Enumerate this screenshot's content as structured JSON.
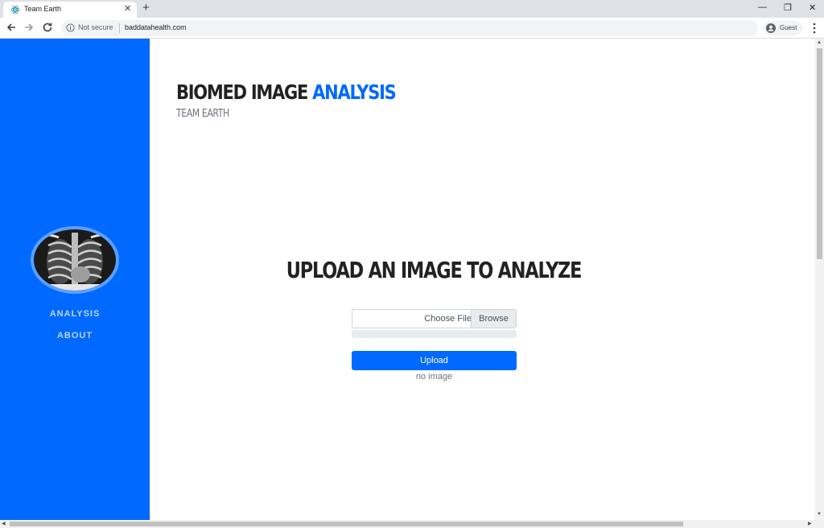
{
  "browser": {
    "tab_title": "Team Earth",
    "tab_close": "✕",
    "new_tab": "+",
    "security_label": "Not secure",
    "url": "baddatahealth.com",
    "profile_label": "Guest",
    "window_controls": {
      "minimize": "—",
      "restore": "❐",
      "close": "✕"
    }
  },
  "sidebar": {
    "nav": [
      {
        "label": "ANALYSIS"
      },
      {
        "label": "ABOUT"
      }
    ]
  },
  "header": {
    "title_main": "BIOMED IMAGE ",
    "title_accent": "ANALYSIS",
    "subtitle": "TEAM EARTH"
  },
  "upload": {
    "heading": "UPLOAD AN IMAGE TO ANALYZE",
    "file_label": "Choose File",
    "browse_label": "Browse",
    "progress": 0,
    "button_label": "Upload",
    "status": "no image"
  },
  "colors": {
    "accent": "#0069ff",
    "sidebar_link": "#b8d4ff"
  },
  "icons": [
    "react-favicon-icon",
    "back-arrow-icon",
    "forward-arrow-icon",
    "reload-icon",
    "info-icon",
    "guest-avatar-icon",
    "kebab-menu-icon",
    "chest-xray-image"
  ]
}
